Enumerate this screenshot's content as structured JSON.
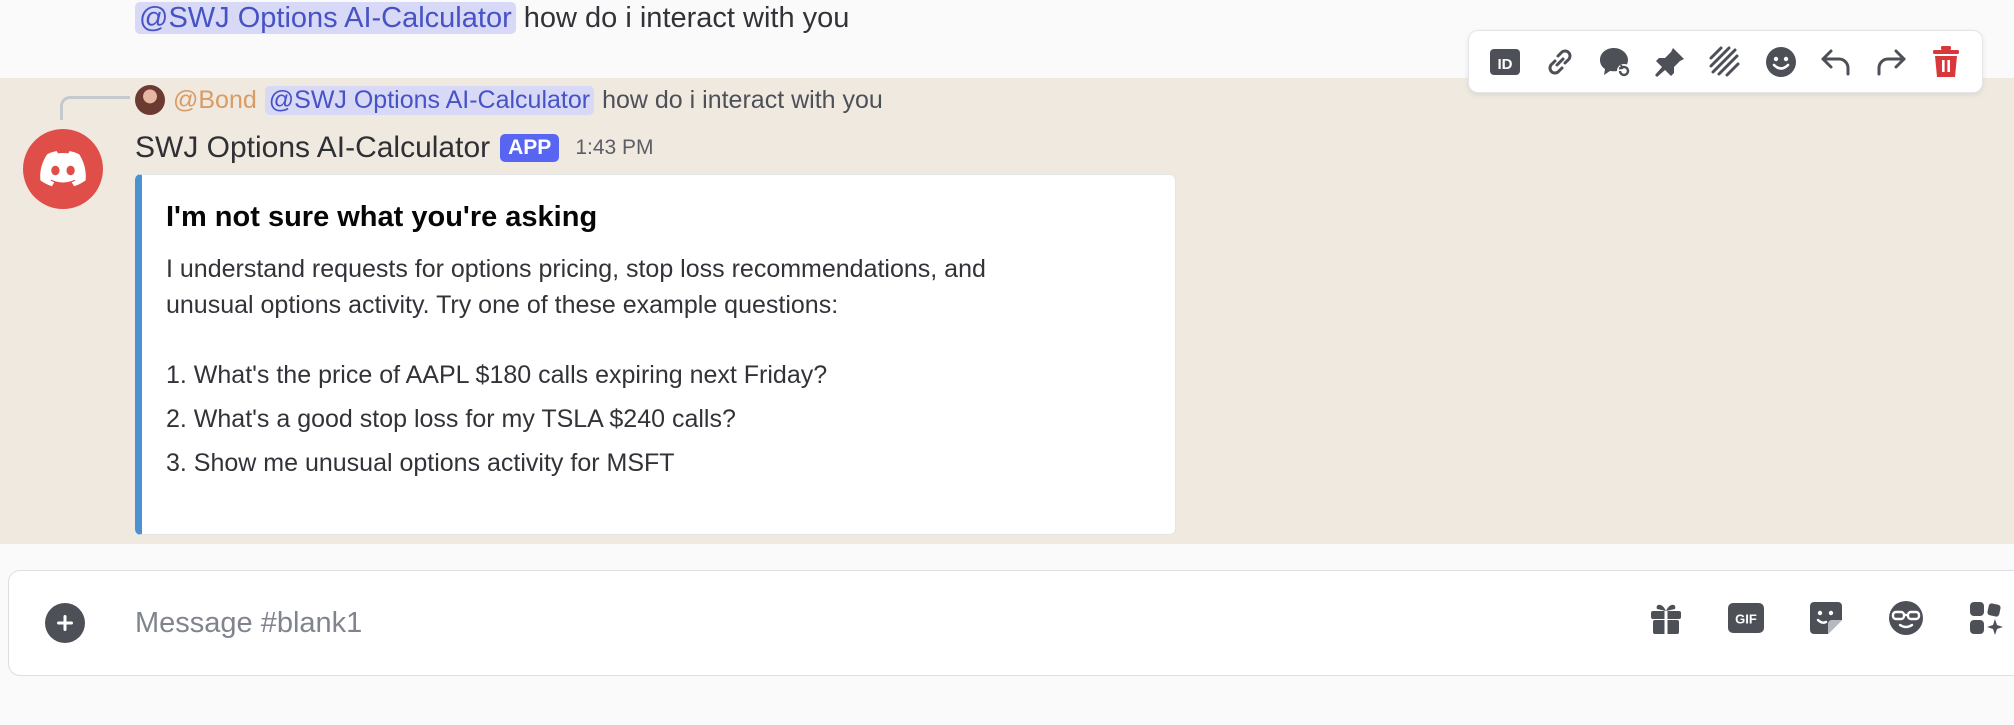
{
  "prev_message": {
    "mention": "@SWJ Options AI-Calculator",
    "text": "how do i interact with you"
  },
  "reply": {
    "author": "@Bond",
    "mention": "@SWJ Options AI-Calculator",
    "text": "how do i interact with you"
  },
  "message": {
    "author": "SWJ Options AI-Calculator",
    "badge": "APP",
    "timestamp": "1:43 PM",
    "avatar_color": "#e04e4a"
  },
  "embed": {
    "accent_color": "#4d91d3",
    "title": "I'm not sure what you're asking",
    "description_line1": "I understand requests for options pricing, stop loss recommendations, and",
    "description_line2": "unusual options activity. Try one of these example questions:",
    "items": [
      "1. What's the price of AAPL $180 calls expiring next Friday?",
      "2. What's a good stop loss for my TSLA $240 calls?",
      "3. Show me unusual options activity for MSFT"
    ]
  },
  "toolbar": {
    "icons": [
      "id-icon",
      "link-icon",
      "thread-icon",
      "pin-icon",
      "mark-unread-icon",
      "reaction-icon",
      "reply-icon",
      "forward-icon",
      "delete-icon"
    ]
  },
  "composer": {
    "placeholder": "Message #blank1",
    "icons": [
      "gift-icon",
      "gif-icon",
      "sticker-icon",
      "emoji-icon",
      "apps-icon"
    ]
  },
  "colors": {
    "highlight_bg": "#f0e9e0",
    "mention_bg": "#d7d9f6",
    "mention_fg": "#4752c4",
    "badge": "#5865f2",
    "delete": "#da373c"
  }
}
